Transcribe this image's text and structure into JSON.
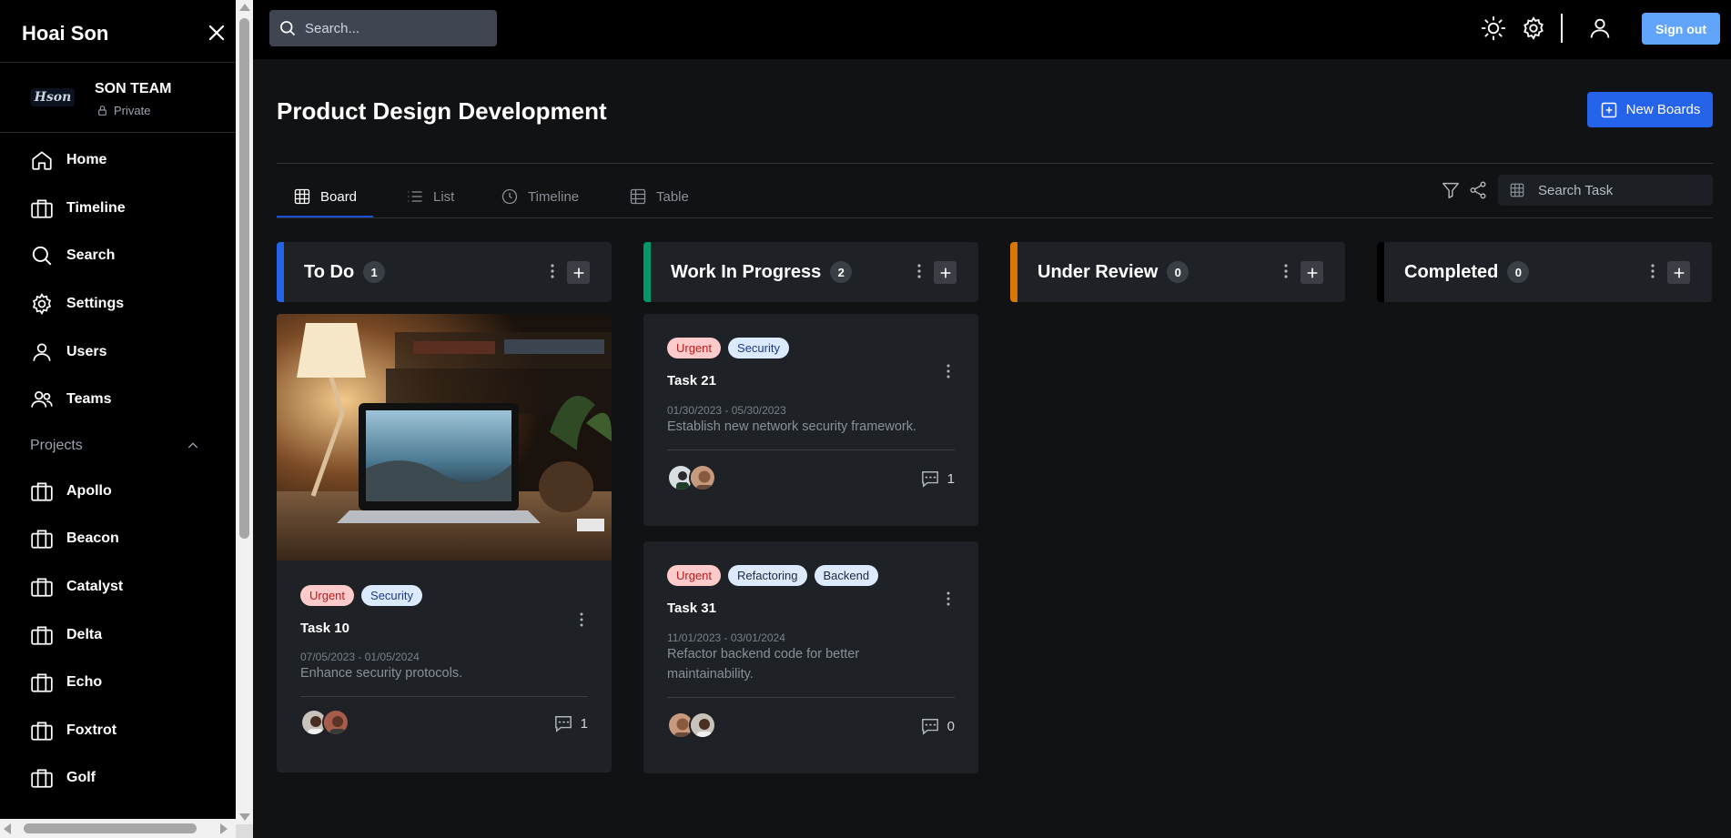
{
  "sidebar": {
    "brand": "Hoai Son",
    "team": {
      "logo_text": "Hson",
      "name": "SON TEAM",
      "visibility": "Private"
    },
    "nav": [
      {
        "label": "Home",
        "icon": "home-icon"
      },
      {
        "label": "Timeline",
        "icon": "briefcase-icon"
      },
      {
        "label": "Search",
        "icon": "search-icon"
      },
      {
        "label": "Settings",
        "icon": "gear-icon"
      },
      {
        "label": "Users",
        "icon": "user-icon"
      },
      {
        "label": "Teams",
        "icon": "users-icon"
      }
    ],
    "projects_label": "Projects",
    "projects": [
      {
        "label": "Apollo"
      },
      {
        "label": "Beacon"
      },
      {
        "label": "Catalyst"
      },
      {
        "label": "Delta"
      },
      {
        "label": "Echo"
      },
      {
        "label": "Foxtrot"
      },
      {
        "label": "Golf"
      }
    ]
  },
  "topbar": {
    "search_placeholder": "Search...",
    "signout_label": "Sign out"
  },
  "main": {
    "title": "Product Design Development",
    "new_board_label": "New Boards",
    "tabs": [
      {
        "label": "Board",
        "active": true
      },
      {
        "label": "List"
      },
      {
        "label": "Timeline"
      },
      {
        "label": "Table"
      }
    ],
    "task_search_placeholder": "Search Task",
    "columns": [
      {
        "title": "To Do",
        "count": "1",
        "color": "#2563eb"
      },
      {
        "title": "Work In Progress",
        "count": "2",
        "color": "#059669"
      },
      {
        "title": "Under Review",
        "count": "0",
        "color": "#d97706"
      },
      {
        "title": "Completed",
        "count": "0",
        "color": "#000000"
      }
    ],
    "cards": [
      {
        "tags": [
          "Urgent",
          "Security"
        ],
        "title": "Task 10",
        "dates": "07/05/2023 - 01/05/2024",
        "desc": "Enhance security protocols.",
        "comments": "1"
      },
      {
        "tags": [
          "Urgent",
          "Security"
        ],
        "title": "Task 21",
        "dates": "01/30/2023 - 05/30/2023",
        "desc": "Establish new network security framework.",
        "comments": "1"
      },
      {
        "tags": [
          "Urgent",
          "Refactoring",
          "Backend"
        ],
        "title": "Task 31",
        "dates": "11/01/2023 - 03/01/2024",
        "desc": "Refactor backend code for better maintainability.",
        "comments": "0"
      }
    ]
  },
  "colors": {
    "accent": "#2563eb",
    "signout": "#60a5fa",
    "urgent_bg": "#fecaca",
    "tag_bg": "#dbeafe"
  }
}
